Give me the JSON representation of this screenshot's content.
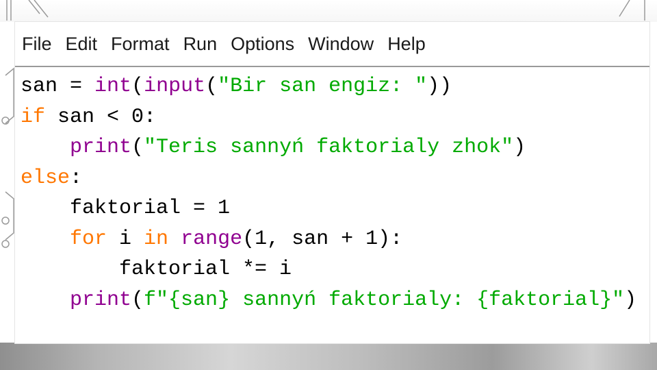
{
  "menu": {
    "items": [
      {
        "label": "File"
      },
      {
        "label": "Edit"
      },
      {
        "label": "Format"
      },
      {
        "label": "Run"
      },
      {
        "label": "Options"
      },
      {
        "label": "Window"
      },
      {
        "label": "Help"
      }
    ]
  },
  "colors": {
    "keyword": "#ff7700",
    "builtin": "#900090",
    "string": "#00aa00",
    "plain": "#000000"
  },
  "code": {
    "lines": [
      {
        "tokens": [
          {
            "t": "san = ",
            "k": "plain"
          },
          {
            "t": "int",
            "k": "builtin"
          },
          {
            "t": "(",
            "k": "plain"
          },
          {
            "t": "input",
            "k": "builtin"
          },
          {
            "t": "(",
            "k": "plain"
          },
          {
            "t": "\"Bir san engiz: \"",
            "k": "str"
          },
          {
            "t": "))",
            "k": "plain"
          }
        ]
      },
      {
        "tokens": [
          {
            "t": "if",
            "k": "kw"
          },
          {
            "t": " san < 0:",
            "k": "plain"
          }
        ]
      },
      {
        "tokens": [
          {
            "t": "    ",
            "k": "plain"
          },
          {
            "t": "print",
            "k": "builtin"
          },
          {
            "t": "(",
            "k": "plain"
          },
          {
            "t": "\"Teris sannyń faktorialy zhok\"",
            "k": "str"
          },
          {
            "t": ")",
            "k": "plain"
          }
        ]
      },
      {
        "tokens": [
          {
            "t": "else",
            "k": "kw"
          },
          {
            "t": ":",
            "k": "plain"
          }
        ]
      },
      {
        "tokens": [
          {
            "t": "    faktorial = 1",
            "k": "plain"
          }
        ]
      },
      {
        "tokens": [
          {
            "t": "    ",
            "k": "plain"
          },
          {
            "t": "for",
            "k": "kw"
          },
          {
            "t": " i ",
            "k": "plain"
          },
          {
            "t": "in",
            "k": "kw"
          },
          {
            "t": " ",
            "k": "plain"
          },
          {
            "t": "range",
            "k": "builtin"
          },
          {
            "t": "(1, san + 1):",
            "k": "plain"
          }
        ]
      },
      {
        "tokens": [
          {
            "t": "        faktorial *= i",
            "k": "plain"
          }
        ]
      },
      {
        "tokens": [
          {
            "t": "    ",
            "k": "plain"
          },
          {
            "t": "print",
            "k": "builtin"
          },
          {
            "t": "(",
            "k": "plain"
          },
          {
            "t": "f\"{san} sannyń faktorialy: {faktorial}\"",
            "k": "str"
          },
          {
            "t": ")",
            "k": "plain"
          }
        ]
      }
    ]
  }
}
